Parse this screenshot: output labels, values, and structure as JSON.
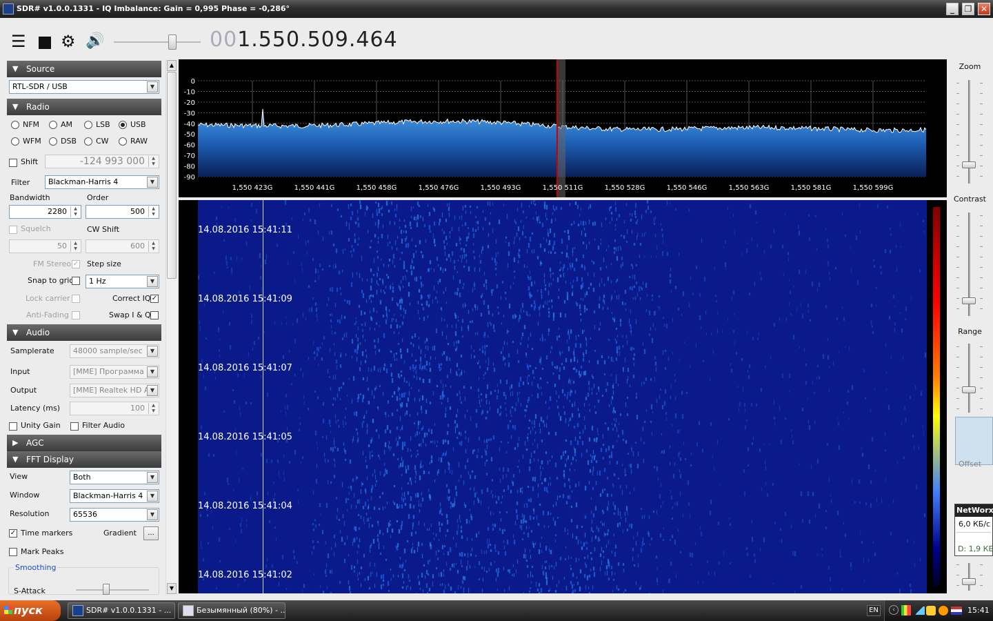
{
  "window": {
    "title": "SDR# v1.0.0.1331 - IQ Imbalance: Gain = 0,995 Phase = -0,286°"
  },
  "toolbar": {
    "frequency_dim": "00",
    "frequency_main": "1.550.509.464"
  },
  "source": {
    "header": "Source",
    "device": "RTL-SDR / USB"
  },
  "radio": {
    "header": "Radio",
    "modes": [
      "NFM",
      "AM",
      "LSB",
      "USB",
      "WFM",
      "DSB",
      "CW",
      "RAW"
    ],
    "selected_mode": "USB",
    "shift_label": "Shift",
    "shift_value": "-124 993 000",
    "filter_label": "Filter",
    "filter_value": "Blackman-Harris 4",
    "bandwidth_label": "Bandwidth",
    "bandwidth_value": "2280",
    "order_label": "Order",
    "order_value": "500",
    "squelch_label": "Squelch",
    "squelch_value": "50",
    "cwshift_label": "CW Shift",
    "cwshift_value": "600",
    "fmstereo_label": "FM Stereo",
    "stepsize_label": "Step size",
    "snap_label": "Snap to grid",
    "stepsize_value": "1 Hz",
    "lockcarrier_label": "Lock carrier",
    "correctiq_label": "Correct IQ",
    "antifading_label": "Anti-Fading",
    "swapiq_label": "Swap I & Q"
  },
  "audio": {
    "header": "Audio",
    "samplerate_label": "Samplerate",
    "samplerate_value": "48000 sample/sec",
    "input_label": "Input",
    "input_value": "[MME] Программа пе",
    "output_label": "Output",
    "output_value": "[MME] Realtek HD Au",
    "latency_label": "Latency (ms)",
    "latency_value": "100",
    "unitygain_label": "Unity Gain",
    "filteraudio_label": "Filter Audio"
  },
  "agc": {
    "header": "AGC"
  },
  "fft": {
    "header": "FFT Display",
    "view_label": "View",
    "view_value": "Both",
    "window_label": "Window",
    "window_value": "Blackman-Harris 4",
    "resolution_label": "Resolution",
    "resolution_value": "65536",
    "timemarkers_label": "Time markers",
    "gradient_label": "Gradient",
    "gradient_btn": "...",
    "markpeaks_label": "Mark Peaks",
    "smoothing_label": "Smoothing",
    "sattack_label": "S-Attack"
  },
  "spectrum": {
    "db_labels": [
      "0",
      "-10",
      "-20",
      "-30",
      "-40",
      "-50",
      "-60",
      "-70",
      "-80",
      "-90"
    ],
    "freq_labels": [
      "1,550 423G",
      "1,550 441G",
      "1,550 458G",
      "1,550 476G",
      "1,550 493G",
      "1,550 511G",
      "1,550 528G",
      "1,550 546G",
      "1,550 563G",
      "1,550 581G",
      "1,550 599G"
    ]
  },
  "waterfall": {
    "timestamps": [
      "14.08.2016 15:41:11",
      "14.08.2016 15:41:09",
      "14.08.2016 15:41:07",
      "14.08.2016 15:41:05",
      "14.08.2016 15:41:04",
      "14.08.2016 15:41:02"
    ]
  },
  "rightpanel": {
    "zoom_label": "Zoom",
    "contrast_label": "Contrast",
    "range_label": "Range",
    "offset_label": "Offset"
  },
  "networx": {
    "title": "NetWorx",
    "speed": "6,0 КБ/с",
    "down": "D: 1,9 КБ"
  },
  "taskbar": {
    "start": "пуск",
    "task1": "SDR# v1.0.0.1331 - ...",
    "task2": "Безымянный (80%) - ...",
    "lang": "EN",
    "clock": "15:41"
  }
}
